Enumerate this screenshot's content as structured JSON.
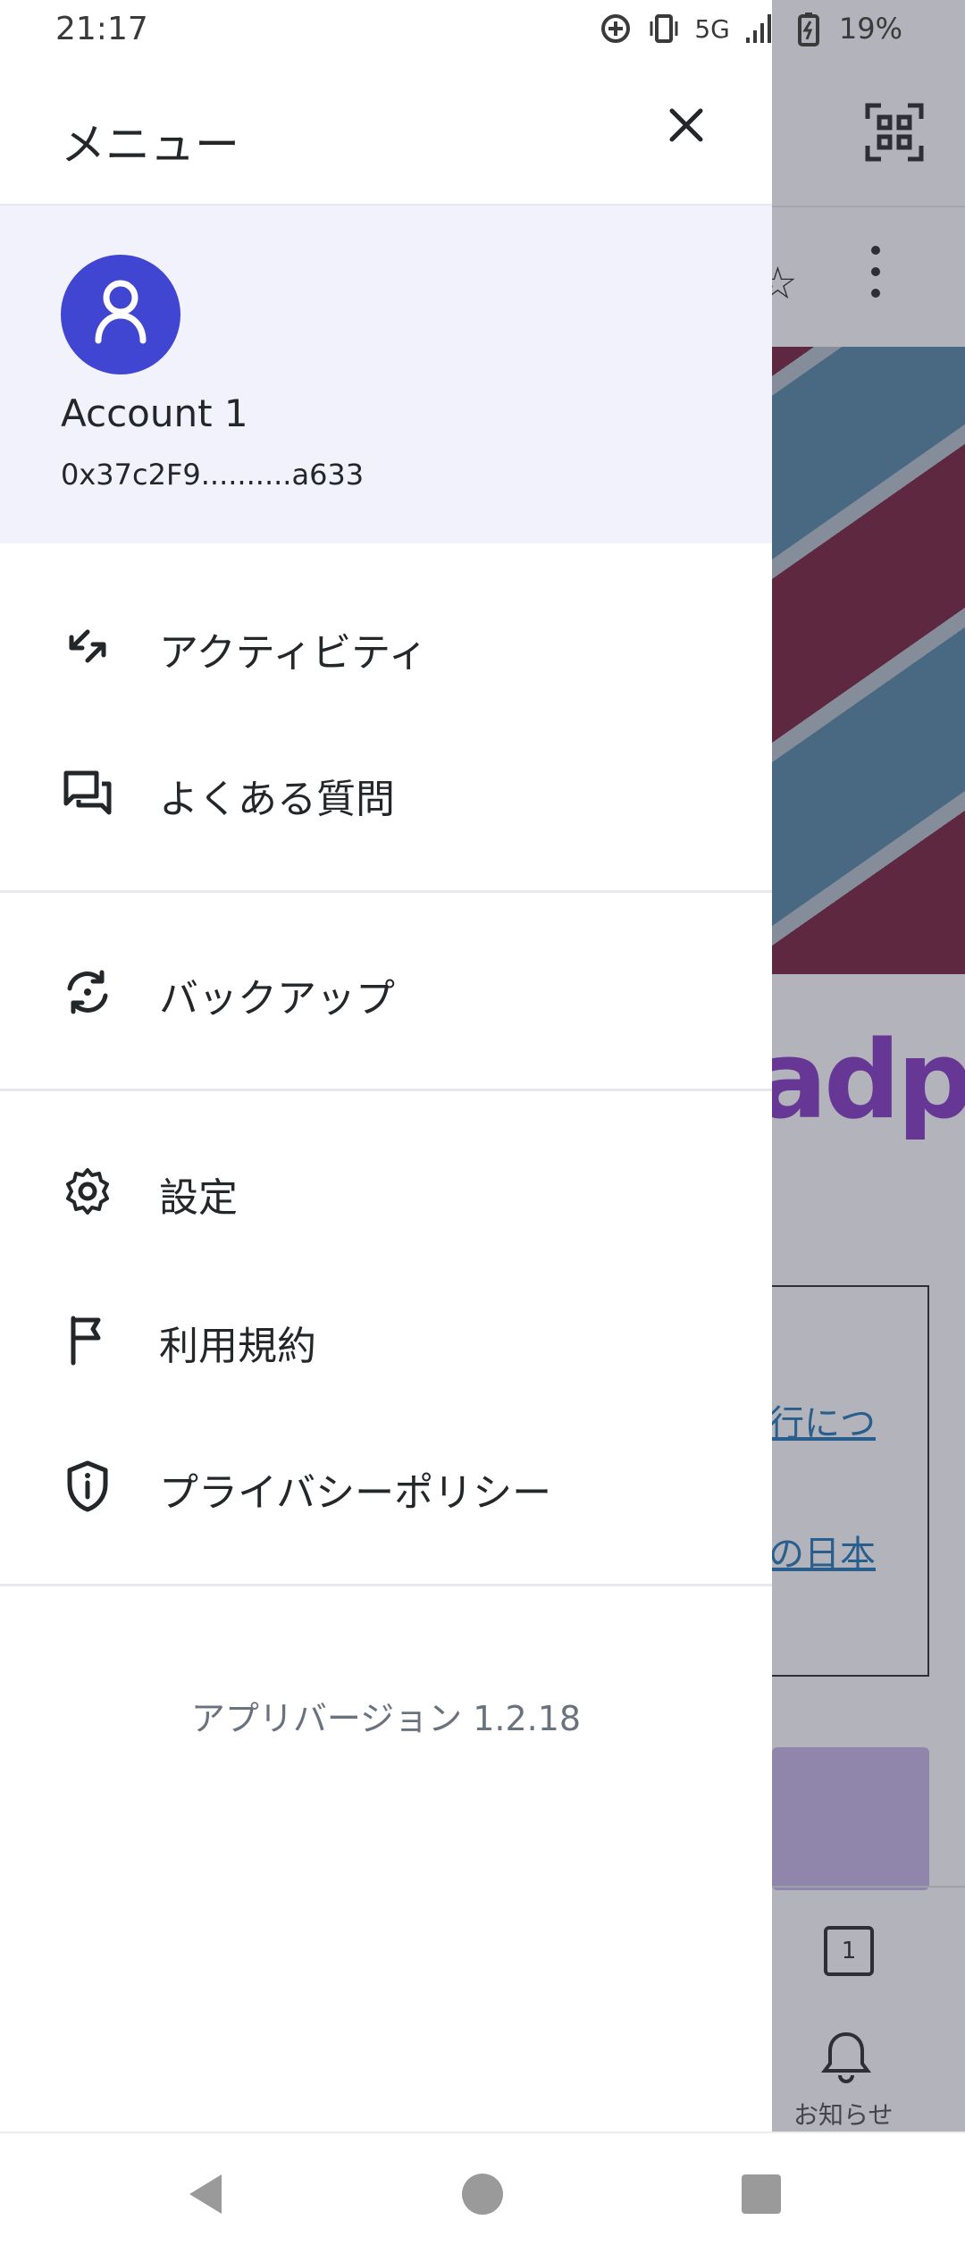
{
  "status_bar": {
    "time": "21:17",
    "network": "5G",
    "battery": "19%"
  },
  "drawer": {
    "title": "メニュー",
    "account": {
      "name": "Account 1",
      "address": "0x37c2F9..........a633"
    },
    "items": [
      {
        "label": "アクティビティ",
        "icon": "activity-arrows-icon"
      },
      {
        "label": "よくある質問",
        "icon": "chat-bubbles-icon"
      },
      {
        "label": "バックアップ",
        "icon": "backup-sync-icon"
      },
      {
        "label": "設定",
        "icon": "gear-icon"
      },
      {
        "label": "利用規約",
        "icon": "flag-icon"
      },
      {
        "label": "プライバシーポリシー",
        "icon": "shield-info-icon"
      }
    ],
    "app_version": "アプリバージョン 1.2.18"
  },
  "background": {
    "logo": "adp",
    "link1": "行につ",
    "link2": "の日本",
    "tab_count": "1",
    "notice_label": "お知らせ"
  },
  "colors": {
    "accent": "#4046d1",
    "account_bg": "#f1f2fc",
    "text": "#24272a"
  }
}
